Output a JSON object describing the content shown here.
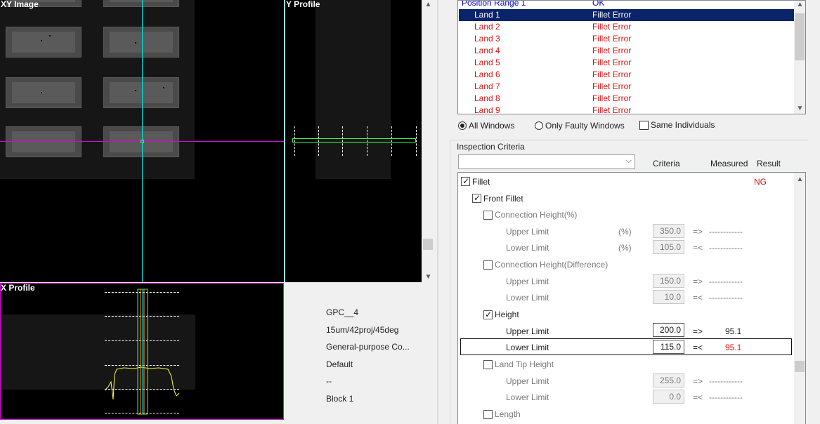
{
  "views": {
    "xy_title": "XY Image",
    "y_profile_title": "Y Profile",
    "x_profile_title": "X Profile"
  },
  "info": {
    "name": "GPC__4",
    "recipe": "15um/42proj/45deg",
    "type": "General-purpose Co...",
    "mode": "Default",
    "extra": "--",
    "block": "Block 1"
  },
  "results_list": [
    {
      "name": "Position Range 1",
      "status": "OK",
      "state": "ok"
    },
    {
      "name": "Land 1",
      "status": "Fillet Error",
      "state": "selected"
    },
    {
      "name": "Land 2",
      "status": "Fillet Error",
      "state": "error"
    },
    {
      "name": "Land 3",
      "status": "Fillet Error",
      "state": "error"
    },
    {
      "name": "Land 4",
      "status": "Fillet Error",
      "state": "error"
    },
    {
      "name": "Land 5",
      "status": "Fillet Error",
      "state": "error"
    },
    {
      "name": "Land 6",
      "status": "Fillet Error",
      "state": "error"
    },
    {
      "name": "Land 7",
      "status": "Fillet Error",
      "state": "error"
    },
    {
      "name": "Land 8",
      "status": "Fillet Error",
      "state": "error"
    },
    {
      "name": "Land 9",
      "status": "Fillet Error",
      "state": "error"
    }
  ],
  "filters": {
    "all_windows": "All Windows",
    "only_faulty": "Only Faulty Windows",
    "same_individuals": "Same Individuals",
    "selected": "all_windows",
    "same_individuals_checked": false
  },
  "criteria_panel": {
    "group_title": "Inspection Criteria",
    "combo_value": "",
    "headers": {
      "criteria": "Criteria",
      "measured": "Measured",
      "result": "Result"
    },
    "fillet": {
      "label": "Fillet",
      "checked": true,
      "result": "NG"
    },
    "front_fillet": {
      "label": "Front Fillet",
      "checked": true
    },
    "connection_height_pct": {
      "label": "Connection Height(%)",
      "checked": false,
      "upper": {
        "label": "Upper Limit",
        "unit": "(%)",
        "value": "350.0",
        "op": "=>",
        "measured": "------------"
      },
      "lower": {
        "label": "Lower Limit",
        "unit": "(%)",
        "value": "105.0",
        "op": "=<",
        "measured": "------------"
      }
    },
    "connection_height_diff": {
      "label": "Connection Height(Difference)",
      "checked": false,
      "upper": {
        "label": "Upper Limit",
        "value": "150.0",
        "op": "=>",
        "measured": "------------"
      },
      "lower": {
        "label": "Lower Limit",
        "value": "10.0",
        "op": "=<",
        "measured": "------------"
      }
    },
    "height": {
      "label": "Height",
      "checked": true,
      "upper": {
        "label": "Upper Limit",
        "value": "200.0",
        "op": "=>",
        "measured": "95.1"
      },
      "lower": {
        "label": "Lower Limit",
        "value": "115.0",
        "op": "=<",
        "measured": "95.1"
      }
    },
    "land_tip_height": {
      "label": "Land Tip Height",
      "checked": false,
      "upper": {
        "label": "Upper Limit",
        "value": "255.0",
        "op": "=>",
        "measured": "------------"
      },
      "lower": {
        "label": "Lower Limit",
        "value": "0.0",
        "op": "=<",
        "measured": "------------"
      }
    },
    "length": {
      "label": "Length",
      "checked": false
    }
  },
  "colors": {
    "cursor_cyan": "#00e5e5",
    "cursor_magenta": "#e000e0",
    "profile_green": "#40ff40",
    "profile_yellow": "#ffff33",
    "error_red": "#e01010",
    "selection_navy": "#0a246a"
  }
}
